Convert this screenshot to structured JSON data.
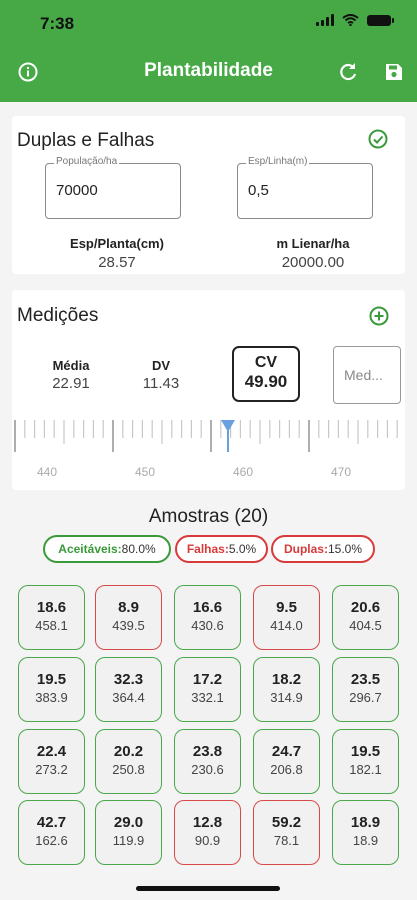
{
  "status": {
    "time": "7:38"
  },
  "appbar": {
    "title": "Plantabilidade",
    "info_icon": "info-icon",
    "refresh_icon": "refresh-icon",
    "save_icon": "save-icon"
  },
  "duplas": {
    "title": "Duplas e Falhas",
    "check_icon": "check-circle-icon",
    "populacao_label": "População/ha",
    "populacao_value": "70000",
    "esp_linha_label": "Esp/Linha(m)",
    "esp_linha_value": "0,5",
    "esp_planta_label": "Esp/Planta(cm)",
    "esp_planta_value": "28.57",
    "m_linear_label": "m Lienar/ha",
    "m_linear_value": "20000.00"
  },
  "medicoes": {
    "title": "Medições",
    "add_icon": "add-circle-icon",
    "media_label": "Média",
    "media_value": "22.91",
    "dv_label": "DV",
    "dv_value": "11.43",
    "cv_label": "CV",
    "cv_value": "49.90",
    "input_placeholder": "Med...",
    "ruler_labels": [
      "440",
      "450",
      "460",
      "470"
    ]
  },
  "amostras": {
    "title": "Amostras (20)",
    "aceitaveis_label": "Aceitáveis:",
    "aceitaveis_value": "80.0%",
    "falhas_label": "Falhas:",
    "falhas_value": "5.0%",
    "duplas_label": "Duplas:",
    "duplas_value": "15.0%"
  },
  "samples": [
    {
      "a": "18.6",
      "b": "458.1",
      "status": "ok"
    },
    {
      "a": "8.9",
      "b": "439.5",
      "status": "bad"
    },
    {
      "a": "16.6",
      "b": "430.6",
      "status": "ok"
    },
    {
      "a": "9.5",
      "b": "414.0",
      "status": "bad"
    },
    {
      "a": "20.6",
      "b": "404.5",
      "status": "ok"
    },
    {
      "a": "19.5",
      "b": "383.9",
      "status": "ok"
    },
    {
      "a": "32.3",
      "b": "364.4",
      "status": "ok"
    },
    {
      "a": "17.2",
      "b": "332.1",
      "status": "ok"
    },
    {
      "a": "18.2",
      "b": "314.9",
      "status": "ok"
    },
    {
      "a": "23.5",
      "b": "296.7",
      "status": "ok"
    },
    {
      "a": "22.4",
      "b": "273.2",
      "status": "ok"
    },
    {
      "a": "20.2",
      "b": "250.8",
      "status": "ok"
    },
    {
      "a": "23.8",
      "b": "230.6",
      "status": "ok"
    },
    {
      "a": "24.7",
      "b": "206.8",
      "status": "ok"
    },
    {
      "a": "19.5",
      "b": "182.1",
      "status": "ok"
    },
    {
      "a": "42.7",
      "b": "162.6",
      "status": "ok"
    },
    {
      "a": "29.0",
      "b": "119.9",
      "status": "ok"
    },
    {
      "a": "12.8",
      "b": "90.9",
      "status": "bad"
    },
    {
      "a": "59.2",
      "b": "78.1",
      "status": "bad"
    },
    {
      "a": "18.9",
      "b": "18.9",
      "status": "ok"
    }
  ],
  "colors": {
    "brand": "#46a946",
    "ok": "#4aa84a",
    "bad": "#d84a4a",
    "ruler_pointer": "#6aa0e0"
  }
}
